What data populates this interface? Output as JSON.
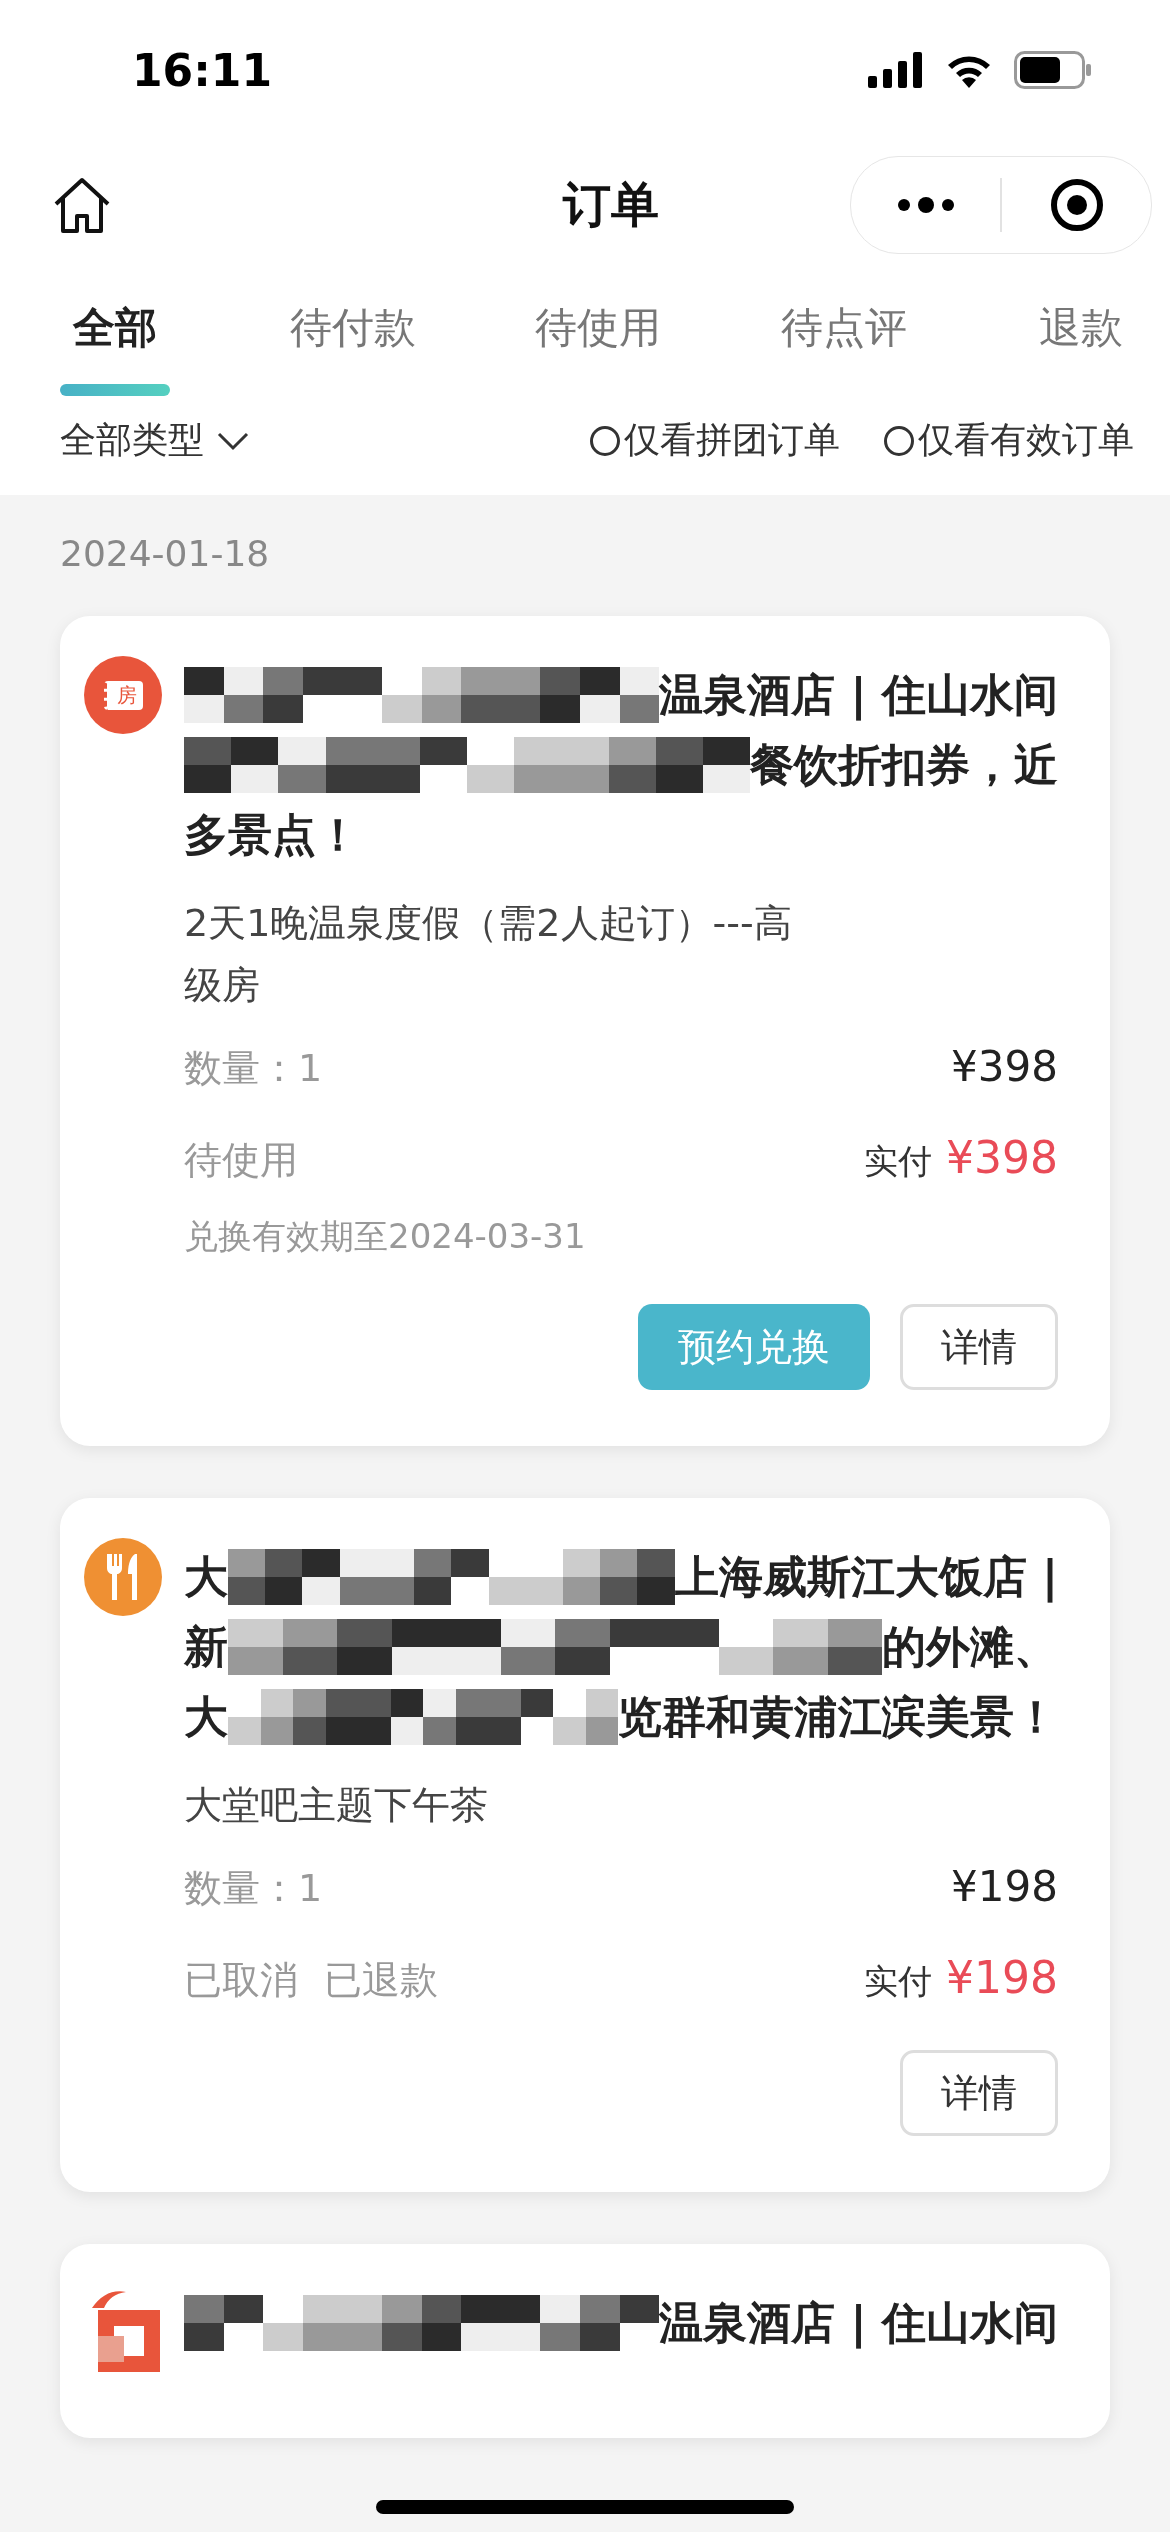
{
  "status_bar": {
    "time": "16:11"
  },
  "nav": {
    "title": "订单"
  },
  "tabs": [
    {
      "label": "全部",
      "selected": true
    },
    {
      "label": "待付款",
      "selected": false
    },
    {
      "label": "待使用",
      "selected": false
    },
    {
      "label": "待点评",
      "selected": false
    },
    {
      "label": "退款",
      "selected": false
    }
  ],
  "filters": {
    "type": "全部类型",
    "options": [
      {
        "label": "仅看拼团订单",
        "checked": false
      },
      {
        "label": "仅看有效订单",
        "checked": false
      }
    ]
  },
  "date": "2024-01-18",
  "orders": [
    {
      "kind": "room",
      "icon_label": "房",
      "color": "#e8553b",
      "title_lines": [
        [
          {
            "kind": "mosaic"
          },
          {
            "kind": "text",
            "text": "温泉酒店 | 住山水间"
          }
        ],
        [
          {
            "kind": "mosaic"
          },
          {
            "kind": "text",
            "text": "餐饮折扣券，近"
          }
        ],
        [
          {
            "kind": "text",
            "text": "多景点！"
          }
        ]
      ],
      "item": "2天1晚温泉度假（需2人起订）---高级房",
      "quantity": "数量：1",
      "price": "¥398",
      "statuses": [
        "待使用"
      ],
      "paid_label": "实付",
      "paid": "¥398",
      "validity": "兑换有效期至2024-03-31",
      "actions": [
        {
          "label": "预约兑换",
          "primary": true
        },
        {
          "label": "详情",
          "primary": false
        }
      ]
    },
    {
      "kind": "dining",
      "color": "#ef9033",
      "title_lines": [
        [
          {
            "kind": "text",
            "text": "大"
          },
          {
            "kind": "mosaic"
          },
          {
            "kind": "text",
            "text": "上海威斯江大饭店 |"
          }
        ],
        [
          {
            "kind": "text",
            "text": "新"
          },
          {
            "kind": "mosaic"
          },
          {
            "kind": "text",
            "text": "的外滩、"
          }
        ],
        [
          {
            "kind": "text",
            "text": "大"
          },
          {
            "kind": "mosaic"
          },
          {
            "kind": "text",
            "text": "览群和黄浦江滨美景！"
          }
        ]
      ],
      "item": "大堂吧主题下午茶",
      "quantity": "数量：1",
      "price": "¥198",
      "statuses": [
        "已取消",
        "已退款"
      ],
      "paid_label": "实付",
      "paid": "¥198",
      "actions": [
        {
          "label": "详情",
          "primary": false
        }
      ]
    },
    {
      "kind": "logo",
      "color": "#e8553b",
      "title_lines": [
        [
          {
            "kind": "mosaic"
          },
          {
            "kind": "text",
            "text": "温泉酒店 | 住山水间"
          }
        ]
      ]
    }
  ]
}
